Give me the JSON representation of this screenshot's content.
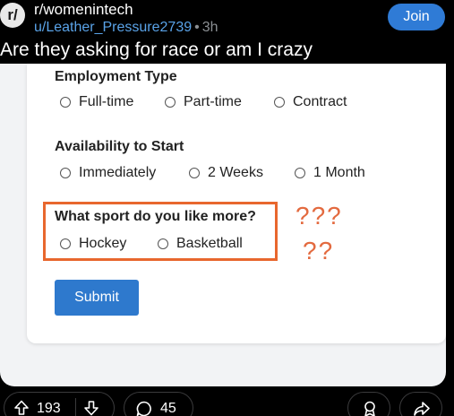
{
  "header": {
    "subreddit_icon": "r/",
    "subreddit": "r/womenintech",
    "username": "u/Leather_Pressure2739",
    "separator": "•",
    "age": "3h",
    "join_label": "Join"
  },
  "post": {
    "title": "Are they asking for race or am I crazy"
  },
  "form": {
    "employment": {
      "title": "Employment Type",
      "options": [
        "Full-time",
        "Part-time",
        "Contract"
      ]
    },
    "availability": {
      "title": "Availability to Start",
      "options": [
        "Immediately",
        "2 Weeks",
        "1 Month"
      ]
    },
    "sport": {
      "title": "What sport do you like more?",
      "options": [
        "Hockey",
        "Basketball"
      ]
    },
    "submit_label": "Submit",
    "annotations": [
      "???",
      "??"
    ],
    "annotation_color": "#e36a3f",
    "highlight_color": "#e8672e"
  },
  "footer": {
    "upvotes": "193",
    "comments": "45",
    "icons": [
      "upvote-icon",
      "downvote-icon",
      "comment-icon",
      "award-icon",
      "share-icon"
    ]
  }
}
